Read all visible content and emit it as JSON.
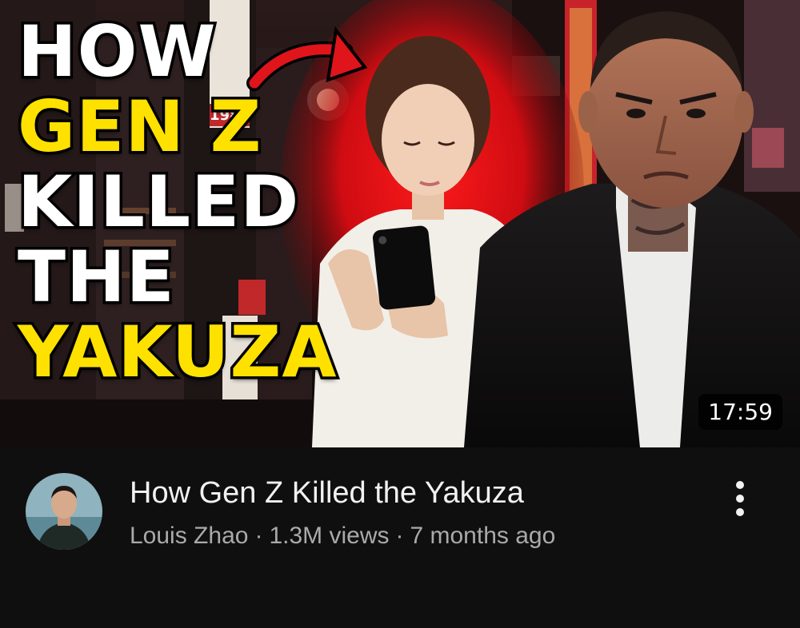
{
  "thumbnail": {
    "headline_lines": [
      {
        "text": "HOW",
        "color": "#ffffff"
      },
      {
        "text": "GEN Z",
        "color": "#ffe100"
      },
      {
        "text": "KILLED",
        "color": "#ffffff"
      },
      {
        "text": "THE",
        "color": "#ffffff"
      },
      {
        "text": "YAKUZA",
        "color": "#ffe100"
      }
    ],
    "sign_text": "1980",
    "duration": "17:59"
  },
  "video": {
    "title": "How Gen Z Killed the Yakuza",
    "channel": "Louis Zhao",
    "separator": "·",
    "views": "1.3M views",
    "age": "7 months ago"
  },
  "colors": {
    "background": "#0f0f0f",
    "title_text": "#f1f1f1",
    "secondary_text": "#aaaaaa",
    "accent_yellow": "#ffe100",
    "accent_red": "#e0141b"
  },
  "icons": {
    "menu": "more-vert-icon"
  }
}
